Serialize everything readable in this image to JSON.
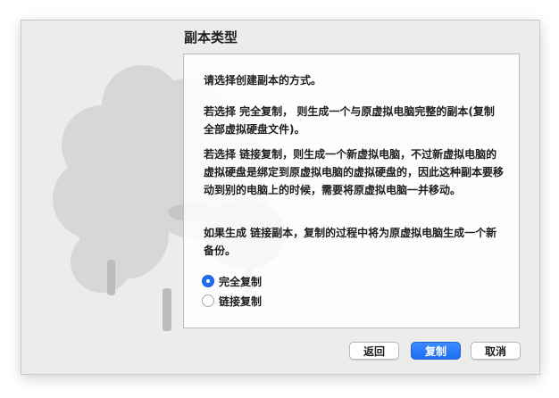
{
  "dialog": {
    "title": "副本类型"
  },
  "content": {
    "intro": "请选择创建副本的方式。",
    "full_clone_desc": "若选择 完全复制， 则生成一个与原虚拟电脑完整的副本(复制全部虚拟硬盘文件)。",
    "linked_clone_desc": "若选择 链接复制，则生成一个新虚拟电脑，不过新虚拟电脑的虚拟硬盘是绑定到原虚拟电脑的虚拟硬盘的，因此这种副本要移动到别的电脑上的时候，需要将原虚拟电脑一并移动。",
    "snapshot_desc": "如果生成 链接副本，复制的过程中将为原虚拟电脑生成一个新备份。"
  },
  "options": {
    "full_clone": {
      "label": "完全复制",
      "selected": true
    },
    "linked_clone": {
      "label": "链接复制",
      "selected": false
    }
  },
  "buttons": {
    "back": "返回",
    "clone": "复制",
    "cancel": "取消"
  },
  "colors": {
    "accent": "#1f6ff0",
    "dialog_bg": "#ececec"
  },
  "icons": {
    "background": "sheep-watermark-icon"
  }
}
